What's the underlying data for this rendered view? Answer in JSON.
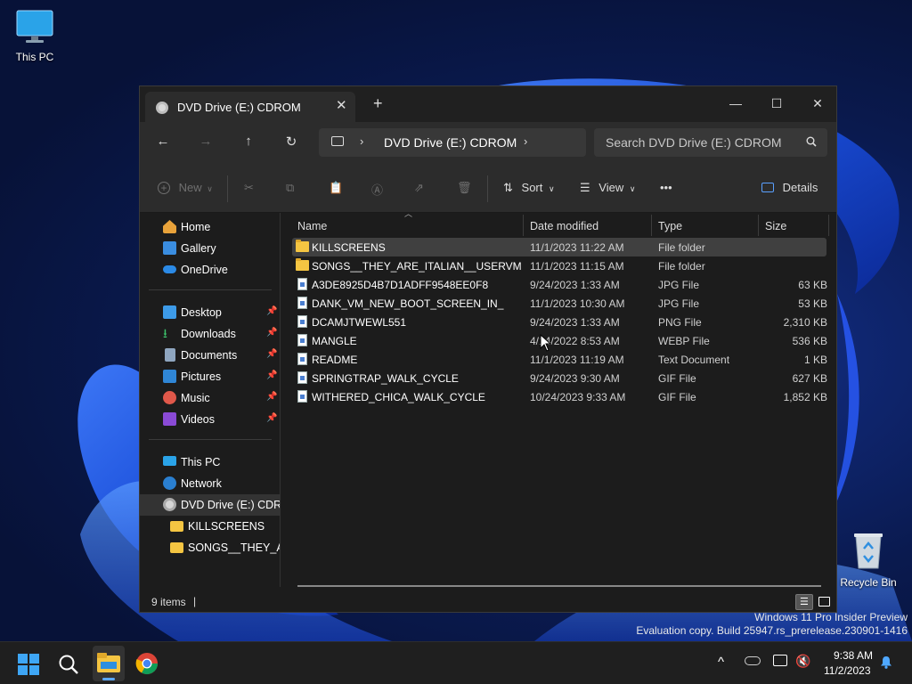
{
  "desktop": {
    "icons": [
      {
        "label": "This PC"
      },
      {
        "label": "Recycle Bin"
      }
    ],
    "watermark": {
      "line1": "Windows 11 Pro Insider Preview",
      "line2": "Evaluation copy. Build 25947.rs_prerelease.230901-1416"
    }
  },
  "window": {
    "tab_title": "DVD Drive (E:) CDROM",
    "tab_close": "✕",
    "new_tab": "+",
    "controls": {
      "minimize": "—",
      "maximize": "☐",
      "close": "✕"
    },
    "nav": {
      "back": "←",
      "forward": "→",
      "up": "↑",
      "refresh": "↻"
    },
    "address": {
      "sep": "›",
      "path": "DVD Drive (E:) CDROM",
      "sep2": "›"
    },
    "search": {
      "placeholder": "Search DVD Drive (E:) CDROM"
    },
    "commands": {
      "new": "New",
      "sort": "Sort",
      "view": "View",
      "more": "•••",
      "details": "Details"
    },
    "sidebar": {
      "home": "Home",
      "gallery": "Gallery",
      "onedrive": "OneDrive",
      "desktop": "Desktop",
      "downloads": "Downloads",
      "documents": "Documents",
      "pictures": "Pictures",
      "music": "Music",
      "videos": "Videos",
      "thispc": "This PC",
      "network": "Network",
      "dvd": "DVD Drive (E:) CDROM",
      "killscreens": "KILLSCREENS",
      "songs": "SONGS__THEY_ARE_ITALIAN__USERVM"
    },
    "columns": {
      "name": "Name",
      "date": "Date modified",
      "type": "Type",
      "size": "Size"
    },
    "files": [
      {
        "name": "KILLSCREENS",
        "date": "11/1/2023 11:22 AM",
        "type": "File folder",
        "size": "",
        "folder": true
      },
      {
        "name": "SONGS__THEY_ARE_ITALIAN__USERVM",
        "date": "11/1/2023 11:15 AM",
        "type": "File folder",
        "size": "",
        "folder": true
      },
      {
        "name": "A3DE8925D4B7D1ADFF9548EE0F8",
        "date": "9/24/2023 1:33 AM",
        "type": "JPG File",
        "size": "63 KB",
        "folder": false
      },
      {
        "name": "DANK_VM_NEW_BOOT_SCREEN_IN_",
        "date": "11/1/2023 10:30 AM",
        "type": "JPG File",
        "size": "53 KB",
        "folder": false
      },
      {
        "name": "DCAMJTWEWL551",
        "date": "9/24/2023 1:33 AM",
        "type": "PNG File",
        "size": "2,310 KB",
        "folder": false
      },
      {
        "name": "MANGLE",
        "date": "4/14/2022 8:53 AM",
        "type": "WEBP File",
        "size": "536 KB",
        "folder": false
      },
      {
        "name": "README",
        "date": "11/1/2023 11:19 AM",
        "type": "Text Document",
        "size": "1 KB",
        "folder": false
      },
      {
        "name": "SPRINGTRAP_WALK_CYCLE",
        "date": "9/24/2023 9:30 AM",
        "type": "GIF File",
        "size": "627 KB",
        "folder": false
      },
      {
        "name": "WITHERED_CHICA_WALK_CYCLE",
        "date": "10/24/2023 9:33 AM",
        "type": "GIF File",
        "size": "1,852 KB",
        "folder": false
      }
    ],
    "status": {
      "count": "9 items",
      "sep": "|"
    }
  },
  "taskbar": {
    "time": "9:38 AM",
    "date": "11/2/2023",
    "tray_chevron": "^"
  }
}
